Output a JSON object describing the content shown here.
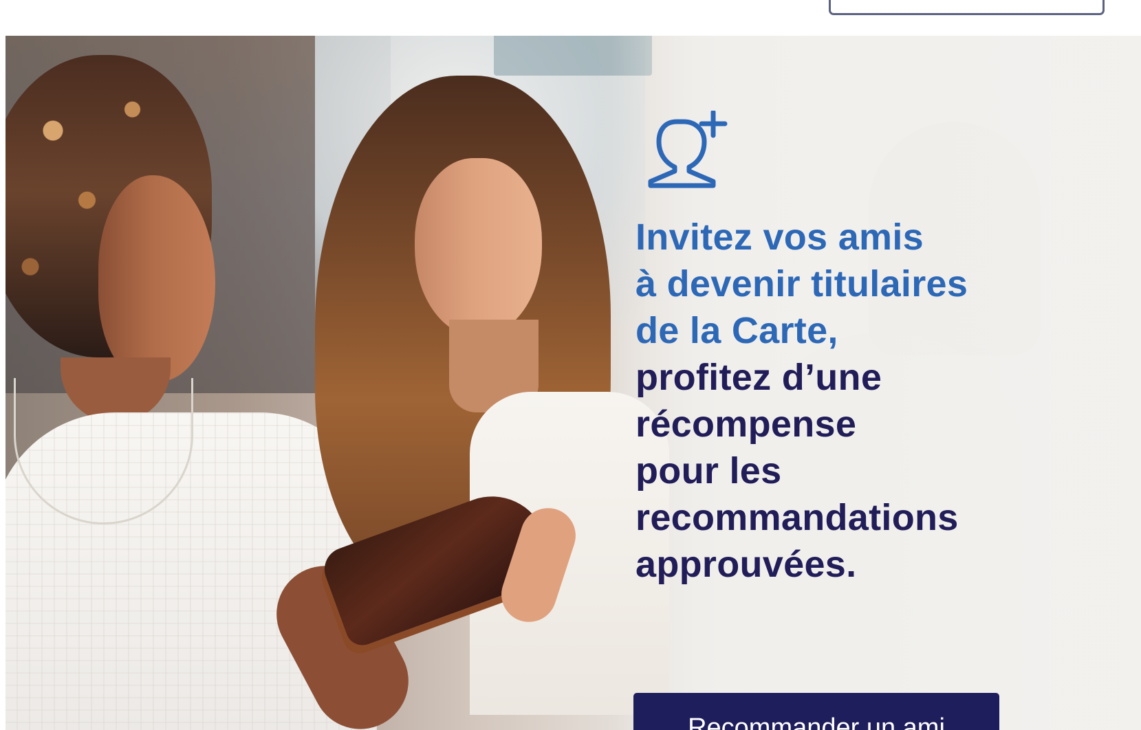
{
  "hero": {
    "icon": "add-user-icon",
    "headline_lines": [
      "Invitez vos amis",
      "à devenir titulaires",
      "de la Carte,",
      "profitez d’une",
      "récompense",
      "pour les",
      "recommandations",
      "approuvées."
    ],
    "cta_label": "Recommander un ami"
  },
  "colors": {
    "headline_blue": "#2d68b7",
    "headline_navy": "#211d59",
    "button_navy": "#1f1e5d",
    "top_button_border": "#5b6280",
    "background": "#f1f0ed"
  }
}
